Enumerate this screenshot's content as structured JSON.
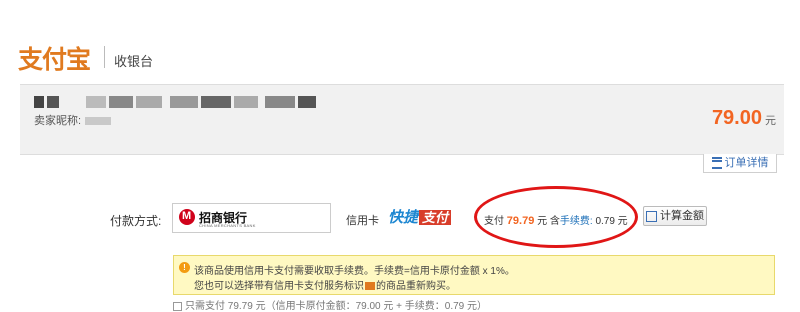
{
  "header": {
    "logo_text": "支付宝",
    "subtitle": "收银台"
  },
  "order": {
    "seller_label": "卖家昵称:",
    "amount": "79.00",
    "amount_unit": "元"
  },
  "detail_button": {
    "label": "订单详情"
  },
  "payment": {
    "method_label": "付款方式:",
    "bank_name": "招商银行",
    "bank_sub": "CHINA MERCHANTS BANK",
    "card_type": "信用卡",
    "quick_pay_text": "快捷",
    "quick_pay_tag": "支付",
    "pay_prefix": "支付",
    "pay_total": "79.79",
    "pay_unit": "元 含",
    "fee_link": "手续费:",
    "fee_value": "0.79 元",
    "calc_button": "计算金额"
  },
  "notice": {
    "line1": "该商品使用信用卡支付需要收取手续费。手续费=信用卡原付金额 x 1%。",
    "line2_a": "您也可以选择带有信用卡支付服务标识",
    "line2_b": "的商品重新购买。"
  },
  "cutoff_text": "只需支付 79.79 元（信用卡原付金额：79.00 元 + 手续费：0.79 元）",
  "colors": {
    "brand": "#e07a1f",
    "amount": "#f26522",
    "link": "#1c6fb8",
    "highlight_oval": "#e01616"
  }
}
